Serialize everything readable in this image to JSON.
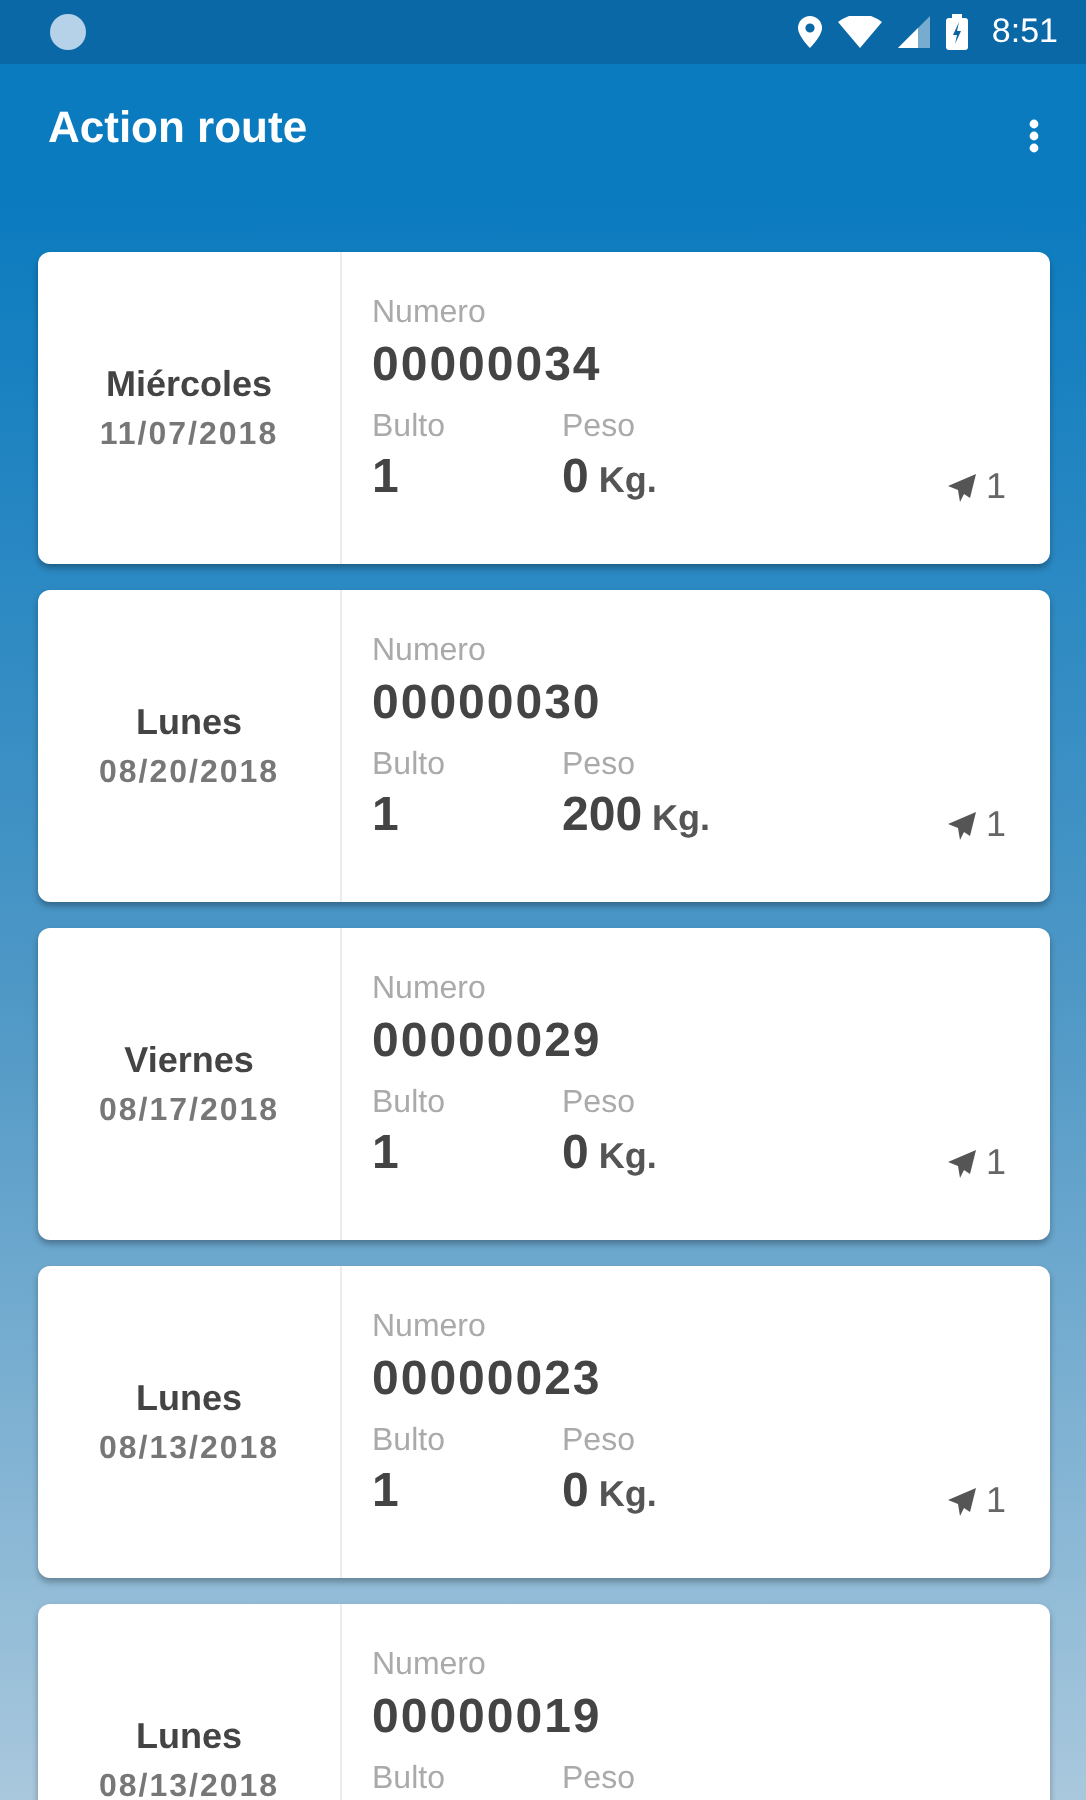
{
  "status_bar": {
    "time": "8:51"
  },
  "app_bar": {
    "title": "Action route"
  },
  "orders": [
    {
      "day": "Miércoles",
      "date": "11/07/2018",
      "numero_label": "Numero",
      "numero": "00000034",
      "bulto_label": "Bulto",
      "bulto": "1",
      "peso_label": "Peso",
      "peso": "0",
      "peso_unit": "Kg.",
      "sent_count": "1"
    },
    {
      "day": "Lunes",
      "date": "08/20/2018",
      "numero_label": "Numero",
      "numero": "00000030",
      "bulto_label": "Bulto",
      "bulto": "1",
      "peso_label": "Peso",
      "peso": "200",
      "peso_unit": "Kg.",
      "sent_count": "1"
    },
    {
      "day": "Viernes",
      "date": "08/17/2018",
      "numero_label": "Numero",
      "numero": "00000029",
      "bulto_label": "Bulto",
      "bulto": "1",
      "peso_label": "Peso",
      "peso": "0",
      "peso_unit": "Kg.",
      "sent_count": "1"
    },
    {
      "day": "Lunes",
      "date": "08/13/2018",
      "numero_label": "Numero",
      "numero": "00000023",
      "bulto_label": "Bulto",
      "bulto": "1",
      "peso_label": "Peso",
      "peso": "0",
      "peso_unit": "Kg.",
      "sent_count": "1"
    },
    {
      "day": "Lunes",
      "date": "08/13/2018",
      "numero_label": "Numero",
      "numero": "00000019",
      "bulto_label": "Bulto",
      "peso_label": "Peso"
    }
  ]
}
